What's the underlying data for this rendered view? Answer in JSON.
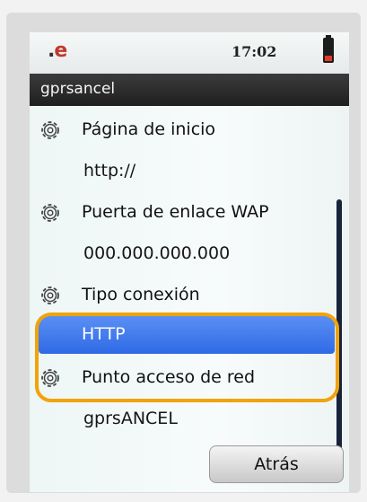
{
  "status_bar": {
    "network_indicator": ".e",
    "time": "17:02",
    "battery_icon": "battery-low-icon"
  },
  "title_bar": {
    "title": "gprsancel"
  },
  "settings_list": [
    {
      "type": "setting",
      "label": "Página de inicio",
      "icon": "gear-icon"
    },
    {
      "type": "value",
      "label": "http://"
    },
    {
      "type": "setting",
      "label": "Puerta de enlace WAP",
      "icon": "gear-icon"
    },
    {
      "type": "value",
      "label": "000.000.000.000"
    },
    {
      "type": "setting",
      "label": "Tipo conexión",
      "icon": "gear-icon"
    },
    {
      "type": "value-selected",
      "label": "HTTP"
    },
    {
      "type": "setting",
      "label": "Punto acceso de red",
      "icon": "gear-icon"
    },
    {
      "type": "value",
      "label": "gprsANCEL"
    }
  ],
  "softkey": {
    "back_label": "Atrás"
  },
  "colors": {
    "highlight": "#f0a30a",
    "selection": "#3a74ea",
    "titlebar": "#2a2a2a"
  }
}
